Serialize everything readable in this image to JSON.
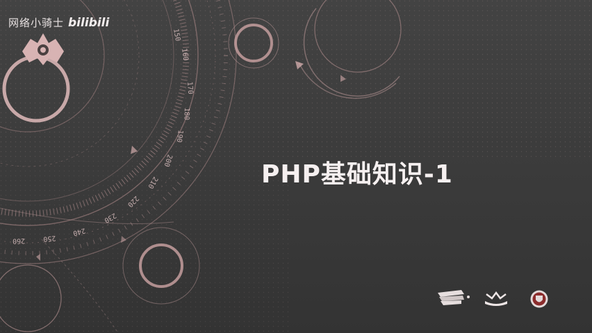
{
  "slide": {
    "title": "PHP基础知识-1"
  },
  "watermark": {
    "channel_name": "网络小骑士",
    "platform": "bilibili",
    "emblem_icon": "knight-helmet-icon"
  },
  "dial_ticks": {
    "t150": "150",
    "t160": "160",
    "t170": "170",
    "t180": "180",
    "t190": "190",
    "t200": "200",
    "t210": "210",
    "t220": "220",
    "t230": "230",
    "t240": "240",
    "t250": "250",
    "t260": "260"
  },
  "footer_logos": [
    {
      "icon": "wing-logo-icon"
    },
    {
      "icon": "crown-logo-icon"
    },
    {
      "icon": "crest-logo-icon"
    }
  ],
  "colors": {
    "accent": "#c9a3a3",
    "background": "#3c3c3c",
    "title": "#f6f0f0"
  }
}
